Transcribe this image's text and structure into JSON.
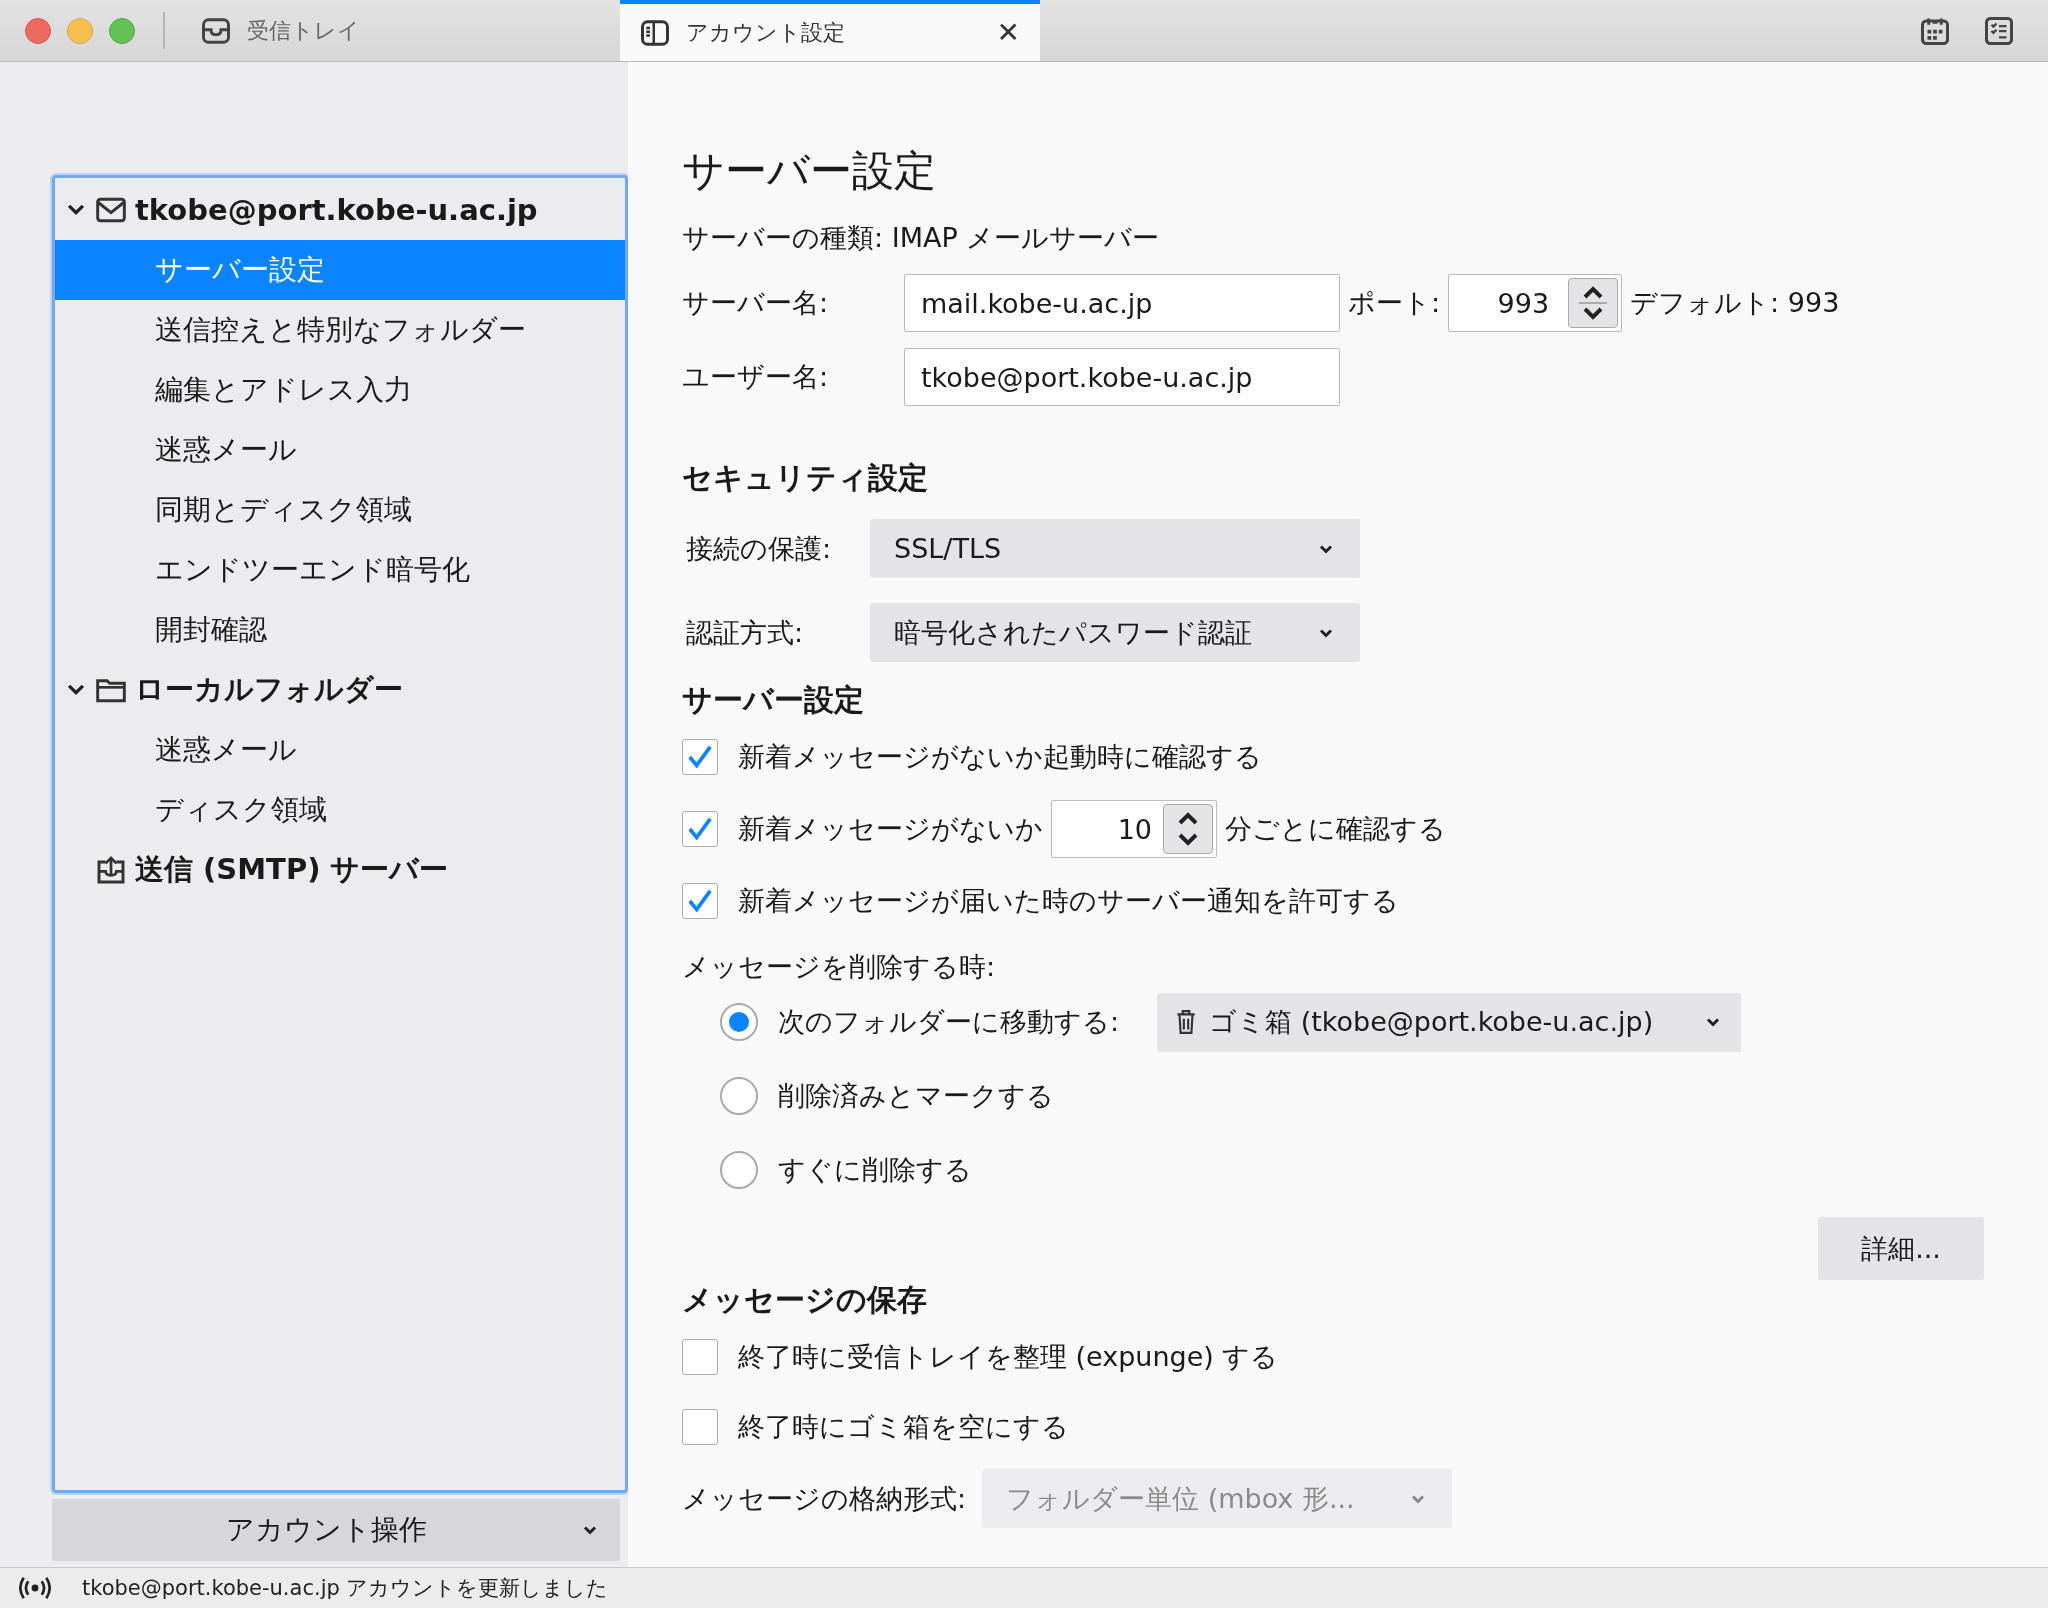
{
  "tabs": [
    {
      "label": "受信トレイ",
      "kind": "inbox",
      "selected": false
    },
    {
      "label": "アカウント設定",
      "kind": "settings",
      "selected": true
    }
  ],
  "close_glyph": "✕",
  "sidebar": {
    "tree": [
      {
        "label": "tkobe@port.kobe-u.ac.jp",
        "kind": "mail",
        "expanded": true,
        "children": [
          {
            "label": "サーバー設定",
            "selected": true
          },
          {
            "label": "送信控えと特別なフォルダー",
            "selected": false
          },
          {
            "label": "編集とアドレス入力",
            "selected": false
          },
          {
            "label": "迷惑メール",
            "selected": false
          },
          {
            "label": "同期とディスク領域",
            "selected": false
          },
          {
            "label": "エンドツーエンド暗号化",
            "selected": false
          },
          {
            "label": "開封確認",
            "selected": false
          }
        ]
      },
      {
        "label": "ローカルフォルダー",
        "kind": "folder",
        "expanded": true,
        "children": [
          {
            "label": "迷惑メール",
            "selected": false
          },
          {
            "label": "ディスク領域",
            "selected": false
          }
        ]
      },
      {
        "label": "送信 (SMTP) サーバー",
        "kind": "outgoing"
      }
    ],
    "account_actions": "アカウント操作"
  },
  "main": {
    "title": "サーバー設定",
    "server_type": "サーバーの種類: IMAP メールサーバー",
    "server_name": {
      "label": "サーバー名:",
      "value": "mail.kobe-u.ac.jp"
    },
    "port": {
      "label": "ポート:",
      "value": "993"
    },
    "port_default": "デフォルト: 993",
    "user_name": {
      "label": "ユーザー名:",
      "value": "tkobe@port.kobe-u.ac.jp"
    },
    "security": {
      "heading": "セキュリティ設定",
      "selects": [
        {
          "label": "接続の保護:",
          "value": "SSL/TLS"
        },
        {
          "label": "認証方式:",
          "value": "暗号化されたパスワード認証"
        }
      ]
    },
    "server_settings": {
      "heading": "サーバー設定",
      "checks": [
        {
          "kind": "plain",
          "label": "新着メッセージがないか起動時に確認する",
          "checked": true
        },
        {
          "kind": "interval",
          "label": "新着メッセージがないか",
          "value": "10",
          "suffix": "分ごとに確認する",
          "checked": true
        },
        {
          "kind": "plain",
          "label": "新着メッセージが届いた時のサーバー通知を許可する",
          "checked": true
        }
      ]
    },
    "delete": {
      "label": "メッセージを削除する時:",
      "options": [
        {
          "kind": "folder",
          "label": "次のフォルダーに移動する:",
          "folder": "ゴミ箱 (tkobe@port.kobe-u.ac.jp)",
          "selected": true
        },
        {
          "kind": "plain",
          "label": "削除済みとマークする",
          "selected": false
        },
        {
          "kind": "plain",
          "label": "すぐに削除する",
          "selected": false
        }
      ]
    },
    "advanced_button": "詳細...",
    "storage": {
      "heading": "メッセージの保存",
      "checks": [
        {
          "label": "終了時に受信トレイを整理 (expunge) する",
          "checked": false
        },
        {
          "label": "終了時にゴミ箱を空にする",
          "checked": false
        }
      ],
      "format": {
        "label": "メッセージの格納形式:",
        "value": "フォルダー単位 (mbox 形...",
        "disabled": true
      }
    }
  },
  "status_bar": {
    "text": "tkobe@port.kobe-u.ac.jp アカウントを更新しました"
  }
}
